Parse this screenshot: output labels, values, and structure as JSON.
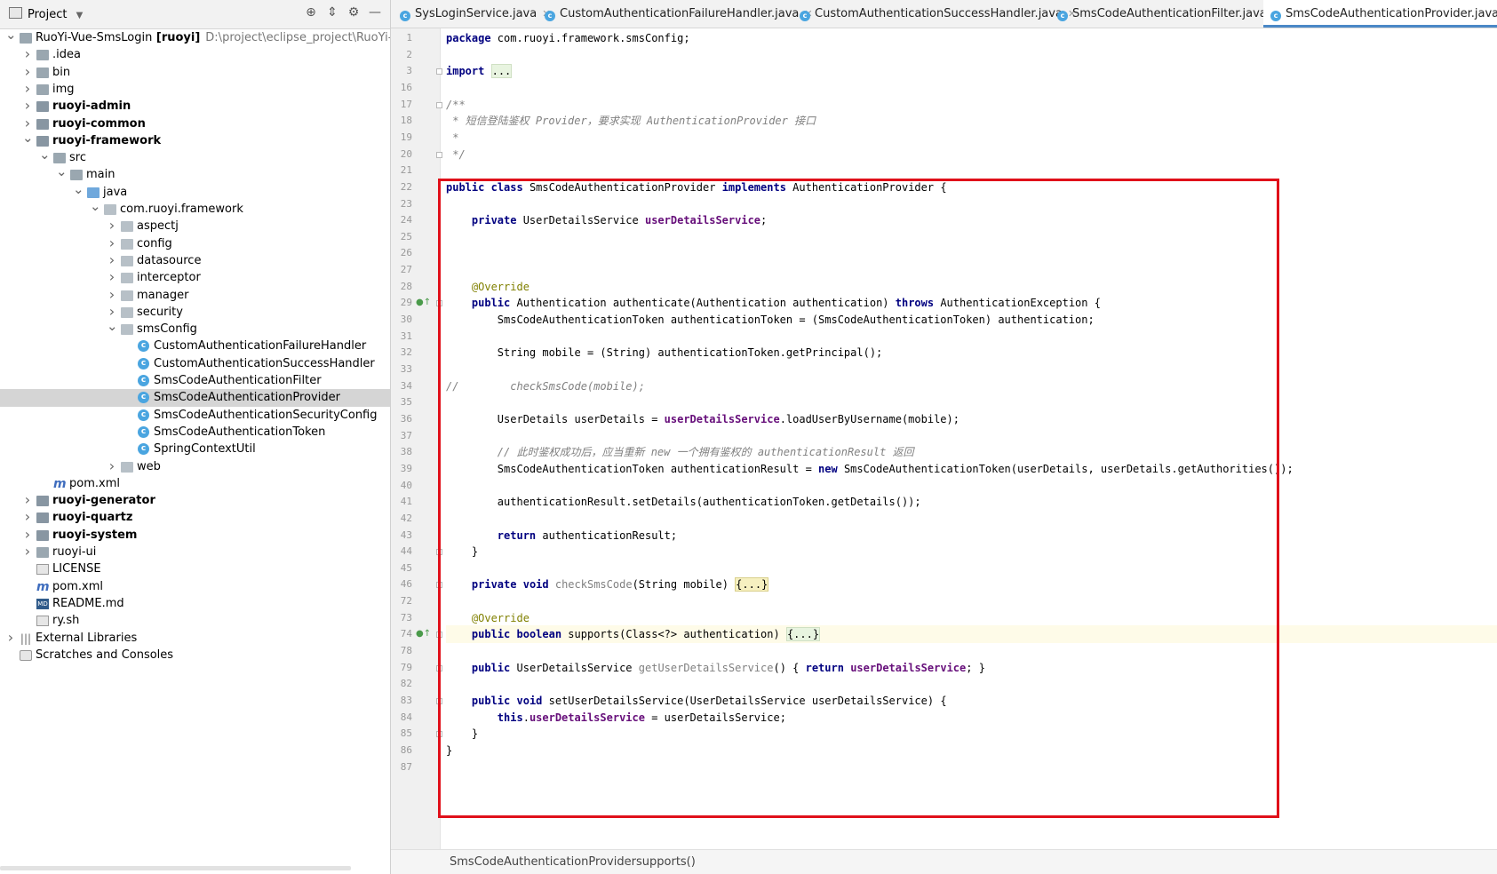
{
  "project_panel": {
    "title": "Project",
    "tree": [
      {
        "label": "RuoYi-Vue-SmsLogin",
        "bold_suffix": "[ruoyi]",
        "path": "D:\\project\\eclipse_project\\RuoYi-Vue-S",
        "icon": "folder-icon"
      },
      {
        "label": ".idea",
        "icon": "folder-icon"
      },
      {
        "label": "bin",
        "icon": "folder-icon"
      },
      {
        "label": "img",
        "icon": "folder-icon"
      },
      {
        "label": "ruoyi-admin",
        "icon": "module-folder-icon"
      },
      {
        "label": "ruoyi-common",
        "icon": "module-folder-icon"
      },
      {
        "label": "ruoyi-framework",
        "icon": "module-folder-icon"
      },
      {
        "label": "src",
        "icon": "folder-icon"
      },
      {
        "label": "main",
        "icon": "folder-icon"
      },
      {
        "label": "java",
        "icon": "source-folder-icon"
      },
      {
        "label": "com.ruoyi.framework",
        "icon": "package-icon"
      },
      {
        "label": "aspectj",
        "icon": "package-icon"
      },
      {
        "label": "config",
        "icon": "package-icon"
      },
      {
        "label": "datasource",
        "icon": "package-icon"
      },
      {
        "label": "interceptor",
        "icon": "package-icon"
      },
      {
        "label": "manager",
        "icon": "package-icon"
      },
      {
        "label": "security",
        "icon": "package-icon"
      },
      {
        "label": "smsConfig",
        "icon": "package-icon"
      },
      {
        "label": "CustomAuthenticationFailureHandler",
        "icon": "class-icon"
      },
      {
        "label": "CustomAuthenticationSuccessHandler",
        "icon": "class-icon"
      },
      {
        "label": "SmsCodeAuthenticationFilter",
        "icon": "class-icon"
      },
      {
        "label": "SmsCodeAuthenticationProvider",
        "icon": "class-icon"
      },
      {
        "label": "SmsCodeAuthenticationSecurityConfig",
        "icon": "class-icon"
      },
      {
        "label": "SmsCodeAuthenticationToken",
        "icon": "class-icon"
      },
      {
        "label": "SpringContextUtil",
        "icon": "class-icon"
      },
      {
        "label": "web",
        "icon": "package-icon"
      },
      {
        "label": "pom.xml",
        "icon": "maven-icon"
      },
      {
        "label": "ruoyi-generator",
        "icon": "module-folder-icon"
      },
      {
        "label": "ruoyi-quartz",
        "icon": "module-folder-icon"
      },
      {
        "label": "ruoyi-system",
        "icon": "module-folder-icon"
      },
      {
        "label": "ruoyi-ui",
        "icon": "folder-icon"
      },
      {
        "label": "LICENSE",
        "icon": "file-icon"
      },
      {
        "label": "pom.xml",
        "icon": "maven-icon"
      },
      {
        "label": "README.md",
        "icon": "markdown-icon"
      },
      {
        "label": "ry.sh",
        "icon": "file-icon"
      },
      {
        "label": "External Libraries",
        "icon": "libraries-icon"
      },
      {
        "label": "Scratches and Consoles",
        "icon": "scratches-icon"
      }
    ]
  },
  "tabs": [
    {
      "label": "SysLoginService.java"
    },
    {
      "label": "CustomAuthenticationFailureHandler.java"
    },
    {
      "label": "CustomAuthenticationSuccessHandler.java"
    },
    {
      "label": "SmsCodeAuthenticationFilter.java"
    },
    {
      "label": "SmsCodeAuthenticationProvider.java",
      "active": true
    }
  ],
  "editor": {
    "line_numbers": [
      "1",
      "2",
      "3",
      "16",
      "17",
      "18",
      "19",
      "20",
      "21",
      "22",
      "23",
      "24",
      "25",
      "26",
      "27",
      "28",
      "29",
      "30",
      "31",
      "32",
      "33",
      "34",
      "35",
      "36",
      "37",
      "38",
      "39",
      "40",
      "41",
      "42",
      "43",
      "44",
      "45",
      "46",
      "72",
      "73",
      "74",
      "78",
      "79",
      "82",
      "83",
      "84",
      "85",
      "86",
      "87"
    ],
    "lines": [
      "package com.ruoyi.framework.smsConfig;",
      "",
      "import ...",
      "",
      "/**",
      " * 短信登陆鉴权 Provider，要求实现 AuthenticationProvider 接口",
      " *",
      " */",
      "",
      "public class SmsCodeAuthenticationProvider implements AuthenticationProvider {",
      "",
      "    private UserDetailsService userDetailsService;",
      "",
      "",
      "",
      "    @Override",
      "    public Authentication authenticate(Authentication authentication) throws AuthenticationException {",
      "        SmsCodeAuthenticationToken authenticationToken = (SmsCodeAuthenticationToken) authentication;",
      "",
      "        String mobile = (String) authenticationToken.getPrincipal();",
      "",
      "//        checkSmsCode(mobile);",
      "",
      "        UserDetails userDetails = userDetailsService.loadUserByUsername(mobile);",
      "",
      "        // 此时鉴权成功后，应当重新 new 一个拥有鉴权的 authenticationResult 返回",
      "        SmsCodeAuthenticationToken authenticationResult = new SmsCodeAuthenticationToken(userDetails, userDetails.getAuthorities());",
      "",
      "        authenticationResult.setDetails(authenticationToken.getDetails());",
      "",
      "        return authenticationResult;",
      "    }",
      "",
      "    private void checkSmsCode(String mobile) {...}",
      "",
      "    @Override",
      "    public boolean supports(Class<?> authentication) {...}",
      "",
      "    public UserDetailsService getUserDetailsService() { return userDetailsService; }",
      "",
      "    public void setUserDetailsService(UserDetailsService userDetailsService) {",
      "        this.userDetailsService = userDetailsService;",
      "    }",
      "}",
      ""
    ]
  },
  "breadcrumb": [
    "SmsCodeAuthenticationProvider",
    "supports()"
  ],
  "colors": {
    "highlight_box": "#e0101a",
    "keyword": "#000080",
    "field": "#660e7a",
    "annotation": "#808000",
    "comment": "#808080"
  }
}
